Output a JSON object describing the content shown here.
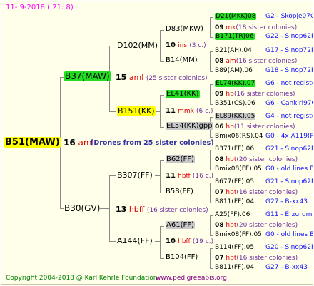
{
  "header": {
    "date": "11-  9-2018 ( 21:  8)"
  },
  "footer": {
    "copyright": "Copyright 2004-2018 @ Karl Kehrle Foundation",
    "site": "www.pedigreeapis.org"
  },
  "root": {
    "name": "B51(MAW)",
    "gen": "16",
    "mating": "aml",
    "note": "[Drones from 25 sister colonies]"
  },
  "dam": {
    "name": "B37(MAW)",
    "gen": "15",
    "mating": "aml",
    "colonies": "(25 sister colonies)"
  },
  "sire": {
    "name": "B30(GV)",
    "gen": "13",
    "mating": "hbff",
    "colonies": "(16 sister colonies)"
  },
  "dam_dam": {
    "name": "D102(MM)",
    "gen": "10",
    "mating": "ins",
    "colonies": "(3 c.)"
  },
  "dam_sire": {
    "name": "B151(KK)",
    "gen": "11",
    "mating": "mmk",
    "colonies": "(6 c.)"
  },
  "sire_dam": {
    "name": "B307(FF)",
    "gen": "11",
    "mating": "hbff",
    "colonies": "(16 c.)"
  },
  "sire_sire": {
    "name": "A144(FF)",
    "gen": "10",
    "mating": "hbff",
    "colonies": "(19 c.)"
  },
  "g3": [
    {
      "name": "D83(MKW)",
      "gen": "09",
      "mating": "mk",
      "colonies": "(18 sister colonies)"
    },
    {
      "name": "B14(MM)",
      "gen": "08",
      "mating": "am",
      "colonies": "(16 sister colonies)"
    },
    {
      "name": "EL41(KK)",
      "gen": "09",
      "mating": "hb",
      "colonies": "(16 sister colonies)"
    },
    {
      "name": "EL54(KK)gpp",
      "gen": "06",
      "mating": "hb",
      "colonies": "(11 sister colonies)"
    },
    {
      "name": "B62(FF)",
      "gen": "08",
      "mating": "hbt",
      "colonies": "(20 sister colonies)"
    },
    {
      "name": "B58(FF)",
      "gen": "07",
      "mating": "hbt",
      "colonies": "(16 sister colonies)"
    },
    {
      "name": "A61(FF)",
      "gen": "08",
      "mating": "hbt",
      "colonies": "(20 sister colonies)"
    },
    {
      "name": "B104(FF)",
      "gen": "07",
      "mating": "hbt",
      "colonies": "(16 sister colonies)"
    }
  ],
  "g4": [
    {
      "name": "D21(MKK)08",
      "code": "G2 - Skopje07Q"
    },
    {
      "name": "B171(TR)06",
      "code": "G22 - Sinop62R"
    },
    {
      "name": "B21(AH).04",
      "code": "G17 - Sinop72R"
    },
    {
      "name": "B89(AM).06",
      "code": "G18 - Sinop72R"
    },
    {
      "name": "EL74(KK).07",
      "code": "G6 - not registe"
    },
    {
      "name": "B351(CS).06",
      "code": "G6 - Cankiri97Q"
    },
    {
      "name": "EL89(KK).05",
      "code": "G4 - not registe"
    },
    {
      "name": "Bmix06(RS).04",
      "code": "G0 - 4x A119(RS)"
    },
    {
      "name": "B371(FF).06",
      "code": "G21 - Sinop62R"
    },
    {
      "name": "Bmix08(FF).05",
      "code": "G0 - old lines B"
    },
    {
      "name": "B677(FF).05",
      "code": "G21 - Sinop62R"
    },
    {
      "name": "B811(FF).04",
      "code": "G27 - B-xx43"
    },
    {
      "name": "A25(FF).06",
      "code": "G11 - ErzurumEgg8"
    },
    {
      "name": "Bmix08(FF).05",
      "code": "G0 - old lines B"
    },
    {
      "name": "B114(FF).05",
      "code": "G20 - Sinop62R"
    },
    {
      "name": "B811(FF).04",
      "code": "G27 - B-xx43"
    }
  ]
}
